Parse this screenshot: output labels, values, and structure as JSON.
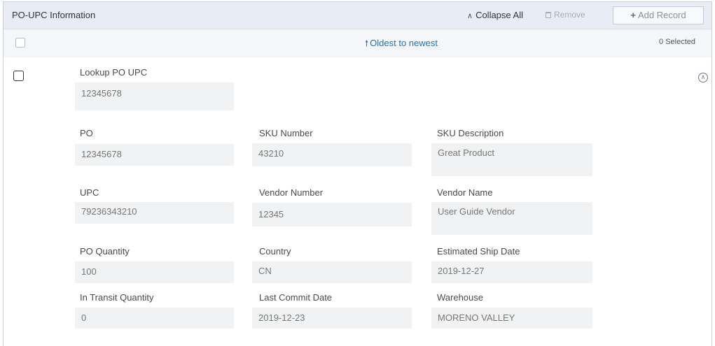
{
  "header": {
    "title": "PO-UPC Information",
    "collapse_all_label": "Collapse All",
    "remove_label": "Remove",
    "add_record_label": "Add Record"
  },
  "subheader": {
    "sort_label": "Oldest to newest",
    "selected_count": "0 Selected"
  },
  "record": {
    "lookup_label": "Lookup PO UPC",
    "lookup_value": "12345678",
    "fields": [
      {
        "label": "PO",
        "value": "12345678"
      },
      {
        "label": "SKU Number",
        "value": "43210"
      },
      {
        "label": "SKU Description",
        "value": "Great Product"
      },
      {
        "label": "UPC",
        "value": "79236343210"
      },
      {
        "label": "Vendor Number",
        "value": "12345"
      },
      {
        "label": "Vendor Name",
        "value": "User Guide Vendor"
      },
      {
        "label": "PO Quantity",
        "value": "100"
      },
      {
        "label": "Country",
        "value": "CN"
      },
      {
        "label": "Estimated Ship Date",
        "value": "2019-12-27"
      },
      {
        "label": "In Transit Quantity",
        "value": "0"
      },
      {
        "label": "Last Commit Date",
        "value": "2019-12-23"
      },
      {
        "label": "Warehouse",
        "value": "MORENO VALLEY"
      }
    ]
  },
  "icons": {
    "collapse_all": "chevron-double-up-icon",
    "remove": "trash-icon",
    "add_record": "plus-icon",
    "sort": "arrow-up-icon",
    "collapse_row": "chevron-up-circle-icon"
  },
  "colors": {
    "header_bg": "#e8edf5",
    "subheader_bg": "#f4f6f9",
    "link": "#1f74b8",
    "field_bg": "#f1f2f3"
  }
}
